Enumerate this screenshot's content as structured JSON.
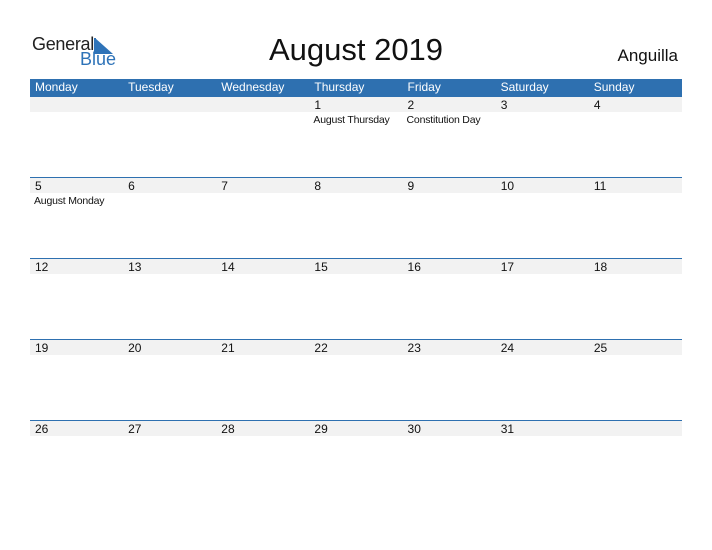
{
  "logo": {
    "word1": "General",
    "word2": "Blue"
  },
  "title": "August 2019",
  "country": "Anguilla",
  "colors": {
    "accent": "#2e70b0",
    "strip": "#f2f2f2"
  },
  "weekdays": [
    "Monday",
    "Tuesday",
    "Wednesday",
    "Thursday",
    "Friday",
    "Saturday",
    "Sunday"
  ],
  "weeks": [
    [
      {
        "d": ""
      },
      {
        "d": ""
      },
      {
        "d": ""
      },
      {
        "d": "1",
        "e": "August Thursday"
      },
      {
        "d": "2",
        "e": "Constitution Day"
      },
      {
        "d": "3"
      },
      {
        "d": "4"
      }
    ],
    [
      {
        "d": "5",
        "e": "August Monday"
      },
      {
        "d": "6"
      },
      {
        "d": "7"
      },
      {
        "d": "8"
      },
      {
        "d": "9"
      },
      {
        "d": "10"
      },
      {
        "d": "11"
      }
    ],
    [
      {
        "d": "12"
      },
      {
        "d": "13"
      },
      {
        "d": "14"
      },
      {
        "d": "15"
      },
      {
        "d": "16"
      },
      {
        "d": "17"
      },
      {
        "d": "18"
      }
    ],
    [
      {
        "d": "19"
      },
      {
        "d": "20"
      },
      {
        "d": "21"
      },
      {
        "d": "22"
      },
      {
        "d": "23"
      },
      {
        "d": "24"
      },
      {
        "d": "25"
      }
    ],
    [
      {
        "d": "26"
      },
      {
        "d": "27"
      },
      {
        "d": "28"
      },
      {
        "d": "29"
      },
      {
        "d": "30"
      },
      {
        "d": "31"
      },
      {
        "d": ""
      }
    ]
  ]
}
